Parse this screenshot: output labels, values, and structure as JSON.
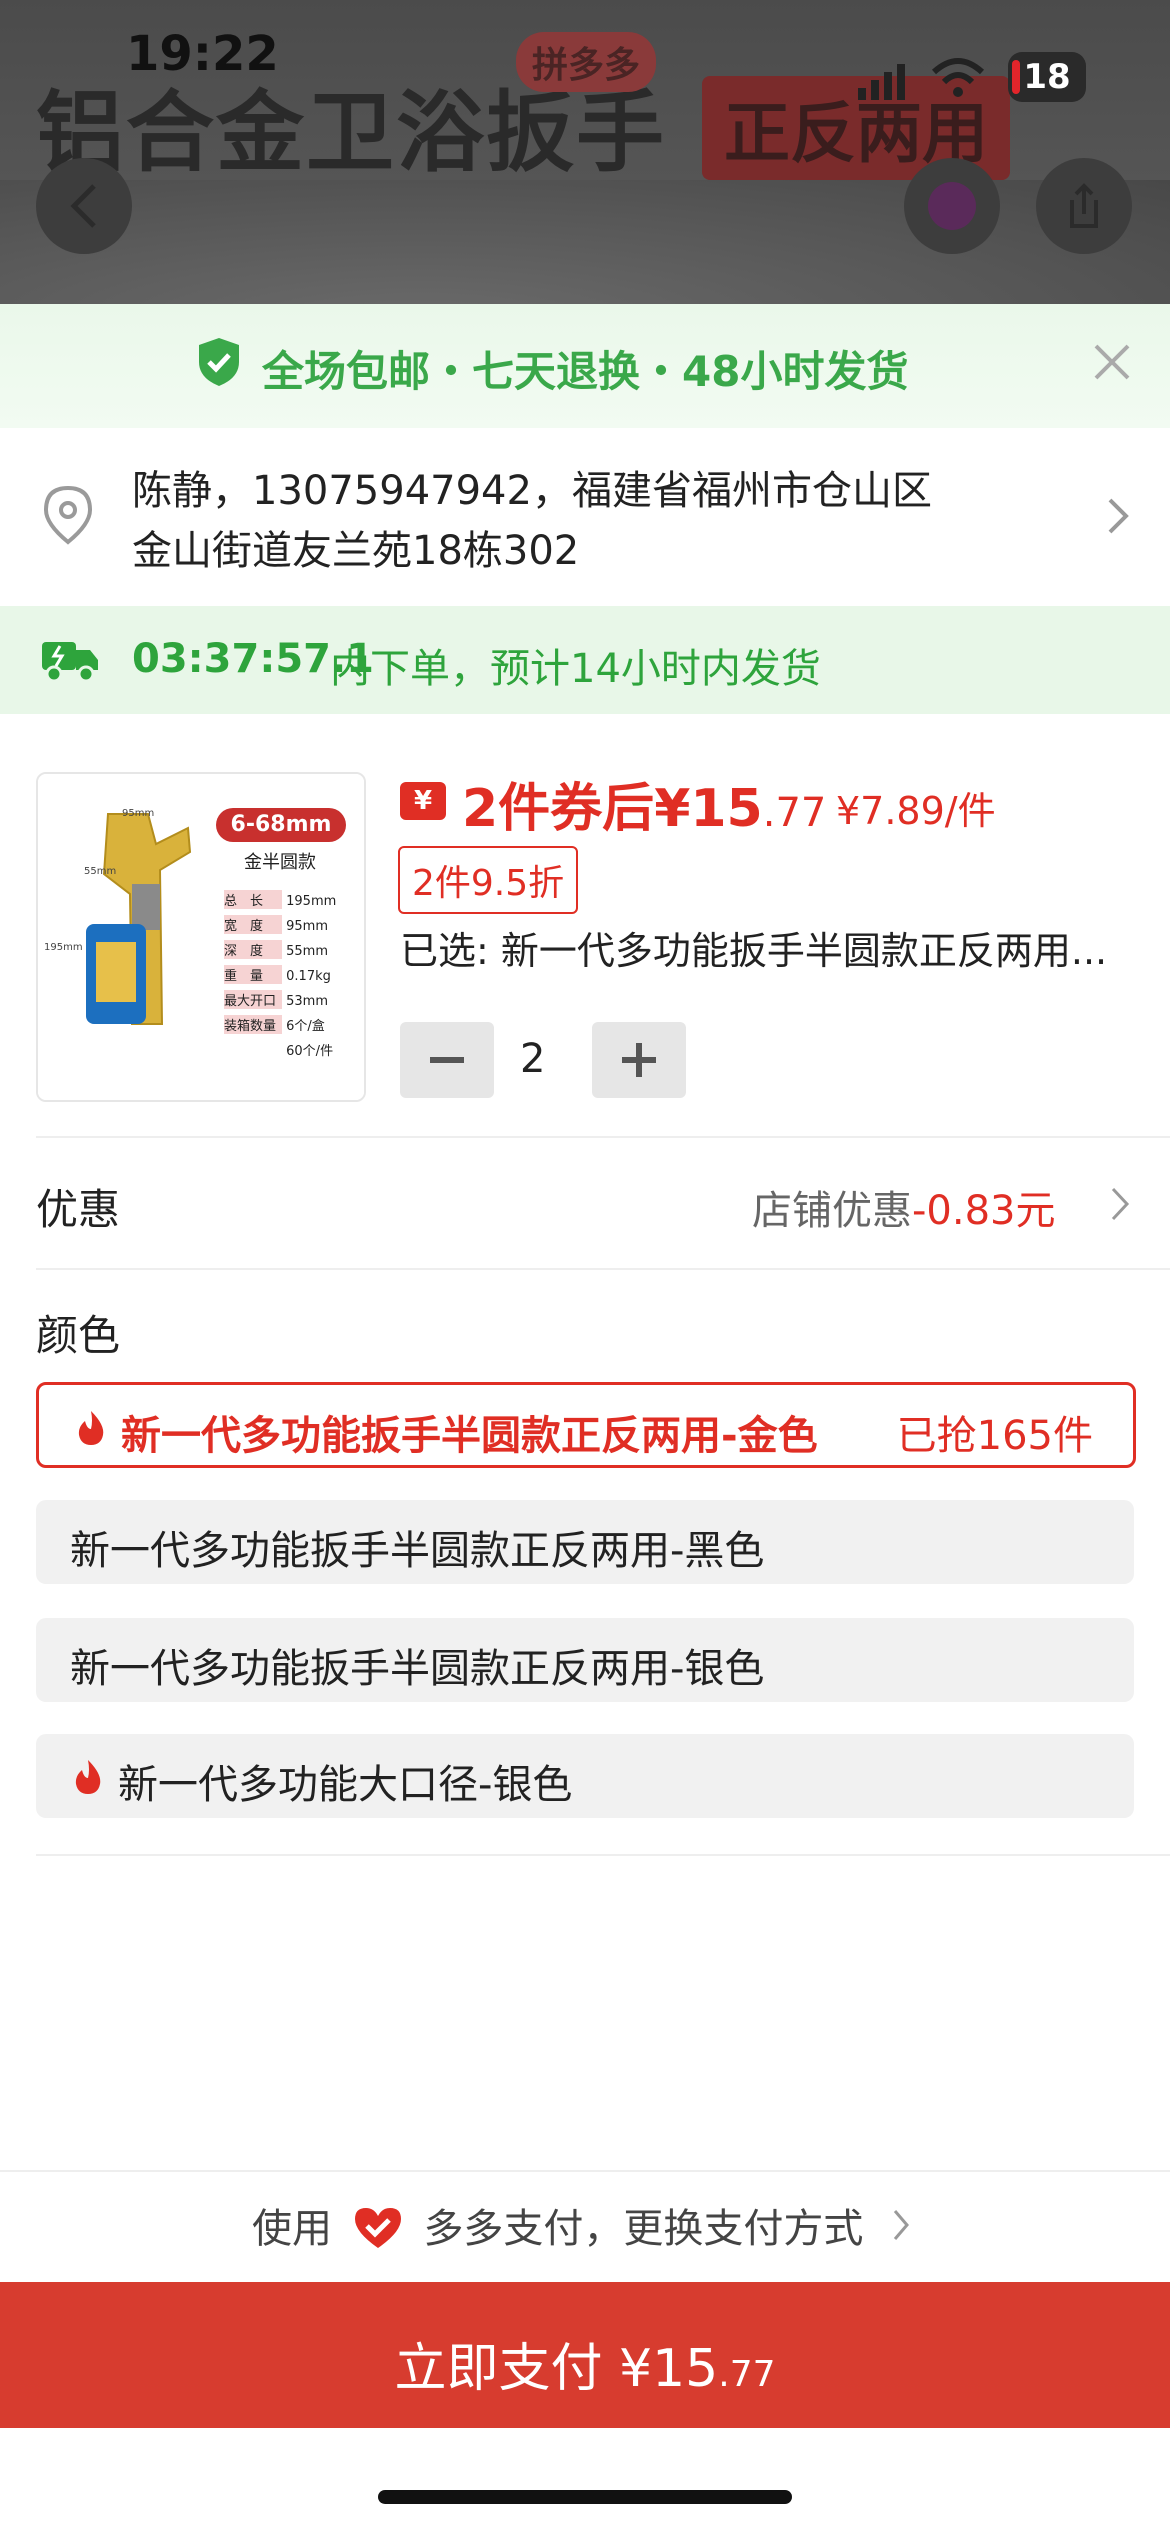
{
  "status_bar": {
    "time": "19:22",
    "battery": "18"
  },
  "background_page": {
    "title": "铝合金卫浴扳手",
    "tag": "正反两用",
    "brand_badge": "拼多多"
  },
  "banner": {
    "text": "全场包邮・七天退换・48小时发货"
  },
  "address": {
    "line1": "陈静，13075947942，福建省福州市仓山区",
    "line2": "金山街道友兰苑18栋302"
  },
  "delivery": {
    "countdown": "03:37:57.1",
    "text": "内下单，预计14小时内发货"
  },
  "product": {
    "image_spec": {
      "size_badge": "6-68mm",
      "model": "金半圆款",
      "specs": [
        {
          "label": "总　长",
          "value": "195mm"
        },
        {
          "label": "宽　度",
          "value": "95mm"
        },
        {
          "label": "深　度",
          "value": "55mm"
        },
        {
          "label": "重　量",
          "value": "0.17kg"
        },
        {
          "label": "最大开口",
          "value": "53mm"
        },
        {
          "label": "装箱数量",
          "value": "6个/盒"
        },
        {
          "label": "",
          "value": "60个/件"
        }
      ],
      "dim_width": "95mm",
      "dim_depth": "55mm",
      "dim_length": "195mm"
    },
    "coupon_icon": "¥",
    "price_prefix": "2件券后",
    "price_currency": "¥",
    "price_integer": "15",
    "price_decimal": ".77",
    "price_per": "¥7.89/件",
    "discount_tag": "2件9.5折",
    "selected": "已选: 新一代多功能扳手半圆款正反两用...",
    "quantity": "2"
  },
  "discount_row": {
    "label": "优惠",
    "value_prefix": "店铺优惠",
    "value_amount": "-0.83元"
  },
  "color_section": {
    "title": "颜色",
    "options": [
      {
        "label": "新一代多功能扳手半圆款正反两用-金色",
        "sold": "已抢165件",
        "selected": true,
        "hot": true
      },
      {
        "label": "新一代多功能扳手半圆款正反两用-黑色",
        "selected": false,
        "hot": false
      },
      {
        "label": "新一代多功能扳手半圆款正反两用-银色",
        "selected": false,
        "hot": false
      },
      {
        "label": "新一代多功能大口径-银色",
        "selected": false,
        "hot": true
      }
    ]
  },
  "payment": {
    "method_prefix": "使用",
    "method_name": "多多支付，更换支付方式",
    "button_label": "立即支付",
    "button_currency": "¥",
    "button_integer": "15",
    "button_decimal": ".77"
  },
  "colors": {
    "accent_red": "#e02e24",
    "green": "#2ea43c",
    "pay_button": "#d73c2f"
  }
}
